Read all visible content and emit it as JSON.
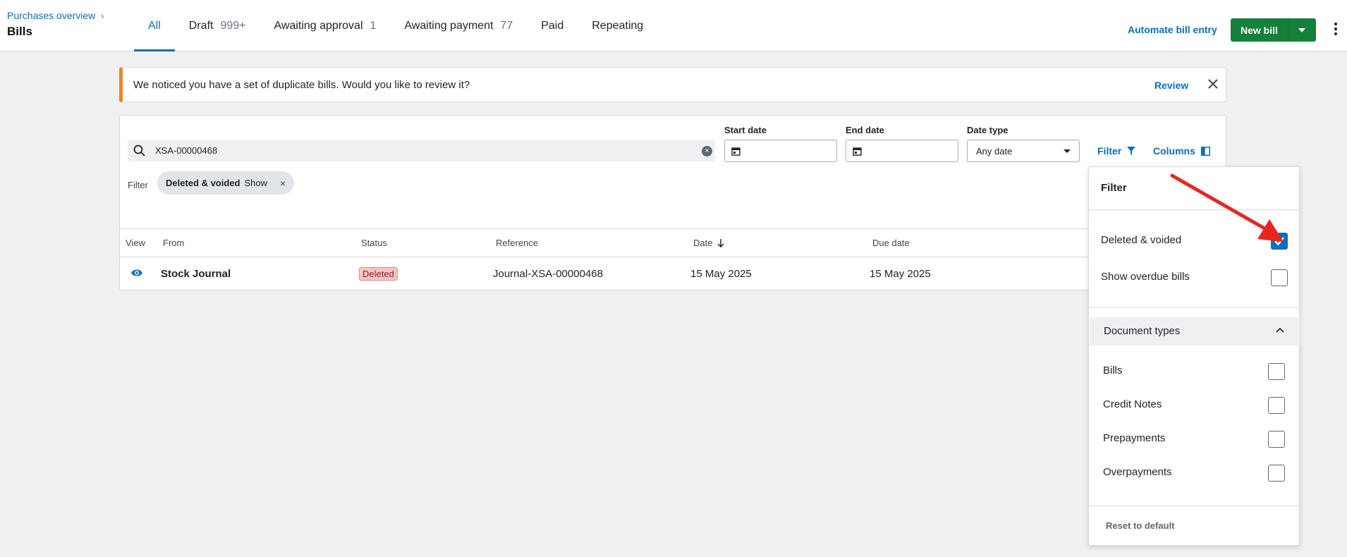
{
  "header": {
    "breadcrumb": "Purchases overview",
    "title": "Bills",
    "tabs": [
      {
        "label": "All",
        "count": ""
      },
      {
        "label": "Draft",
        "count": "999+"
      },
      {
        "label": "Awaiting approval",
        "count": "1"
      },
      {
        "label": "Awaiting payment",
        "count": "77"
      },
      {
        "label": "Paid",
        "count": ""
      },
      {
        "label": "Repeating",
        "count": ""
      }
    ],
    "automate_label": "Automate bill entry",
    "new_bill_label": "New bill"
  },
  "banner": {
    "message": "We noticed you have a set of duplicate bills. Would you like to review it?",
    "review_label": "Review"
  },
  "search": {
    "value": "XSA-00000468"
  },
  "filters": {
    "start_date_label": "Start date",
    "end_date_label": "End date",
    "date_type_label": "Date type",
    "date_type_value": "Any date",
    "filter_button": "Filter",
    "columns_button": "Columns",
    "filter_label": "Filter",
    "chip_name": "Deleted & voided",
    "chip_value": "Show"
  },
  "table": {
    "headers": [
      "View",
      "From",
      "Status",
      "Reference",
      "Date",
      "Due date"
    ],
    "rows": [
      {
        "from": "Stock Journal",
        "status": "Deleted",
        "reference": "Journal-XSA-00000468",
        "date": "15 May 2025",
        "due_date": "15 May 2025"
      }
    ]
  },
  "filter_panel": {
    "title": "Filter",
    "deleted_voided": "Deleted & voided",
    "show_overdue": "Show overdue bills",
    "document_types": "Document types",
    "doc_items": [
      "Bills",
      "Credit Notes",
      "Prepayments",
      "Overpayments"
    ],
    "reset": "Reset to default"
  },
  "colors": {
    "accent": "#0b6fbe",
    "primary_button": "#157f3c",
    "banner_accent": "#f5831f",
    "annotation": "#e8261f"
  }
}
